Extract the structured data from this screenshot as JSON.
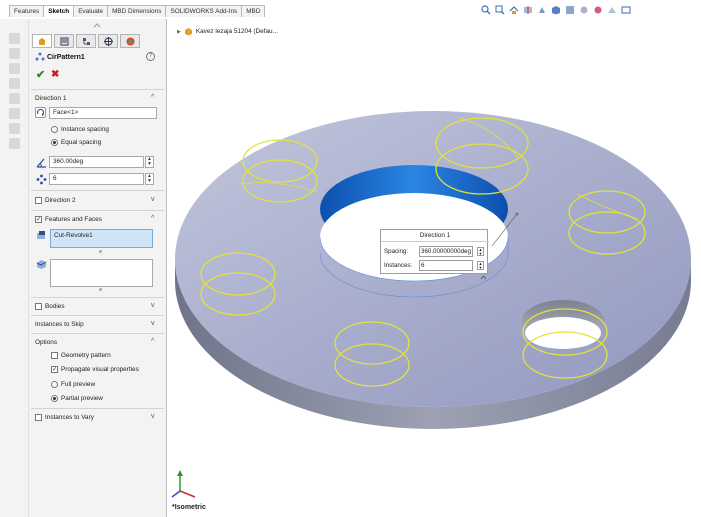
{
  "tabs": [
    "Features",
    "Sketch",
    "Evaluate",
    "MBD Dimensions",
    "SOLIDWORKS Add-Ins",
    "MBD"
  ],
  "active_tab": "Sketch",
  "tree_root": "Kavez lezaja 51204  (Defau...",
  "feature_title": "CirPattern1",
  "help_symbol": "?",
  "direction1": {
    "header": "Direction 1",
    "reference": "Face<1>",
    "instance_spacing": "Instance spacing",
    "equal_spacing": "Equal spacing",
    "angle": "360.00deg",
    "count": "6"
  },
  "direction2": {
    "header": "Direction 2"
  },
  "features_faces": {
    "header": "Features and Faces",
    "item": "Cut-Revolve1"
  },
  "bodies": {
    "header": "Bodies"
  },
  "instances_to_skip": {
    "header": "Instances to Skip"
  },
  "options": {
    "header": "Options",
    "geometry_pattern": "Geometry pattern",
    "propagate": "Propagate visual properties",
    "full_preview": "Full preview",
    "partial_preview": "Partial preview"
  },
  "instances_to_vary": {
    "header": "Instances to Vary"
  },
  "callout": {
    "title": "Direction 1",
    "spacing_label": "Spacing:",
    "spacing_value": "360.00000000deg",
    "instances_label": "Instances:",
    "instances_value": "6"
  },
  "view_name": "*Isometric",
  "colors": {
    "preview": "#e2e23a",
    "selected_face": "#1e6fd0",
    "part": "#9aa0c4",
    "ok": "#2f8a2f",
    "cancel": "#c62020"
  },
  "icons": [
    "search-icon",
    "zoom-area-icon",
    "previous-view-icon",
    "section-view-icon",
    "dynamic-annotation-icon",
    "view-orientation-icon",
    "display-style-icon",
    "hide-show-icon",
    "edit-appearance-icon",
    "apply-scene-icon",
    "view-settings-icon"
  ]
}
